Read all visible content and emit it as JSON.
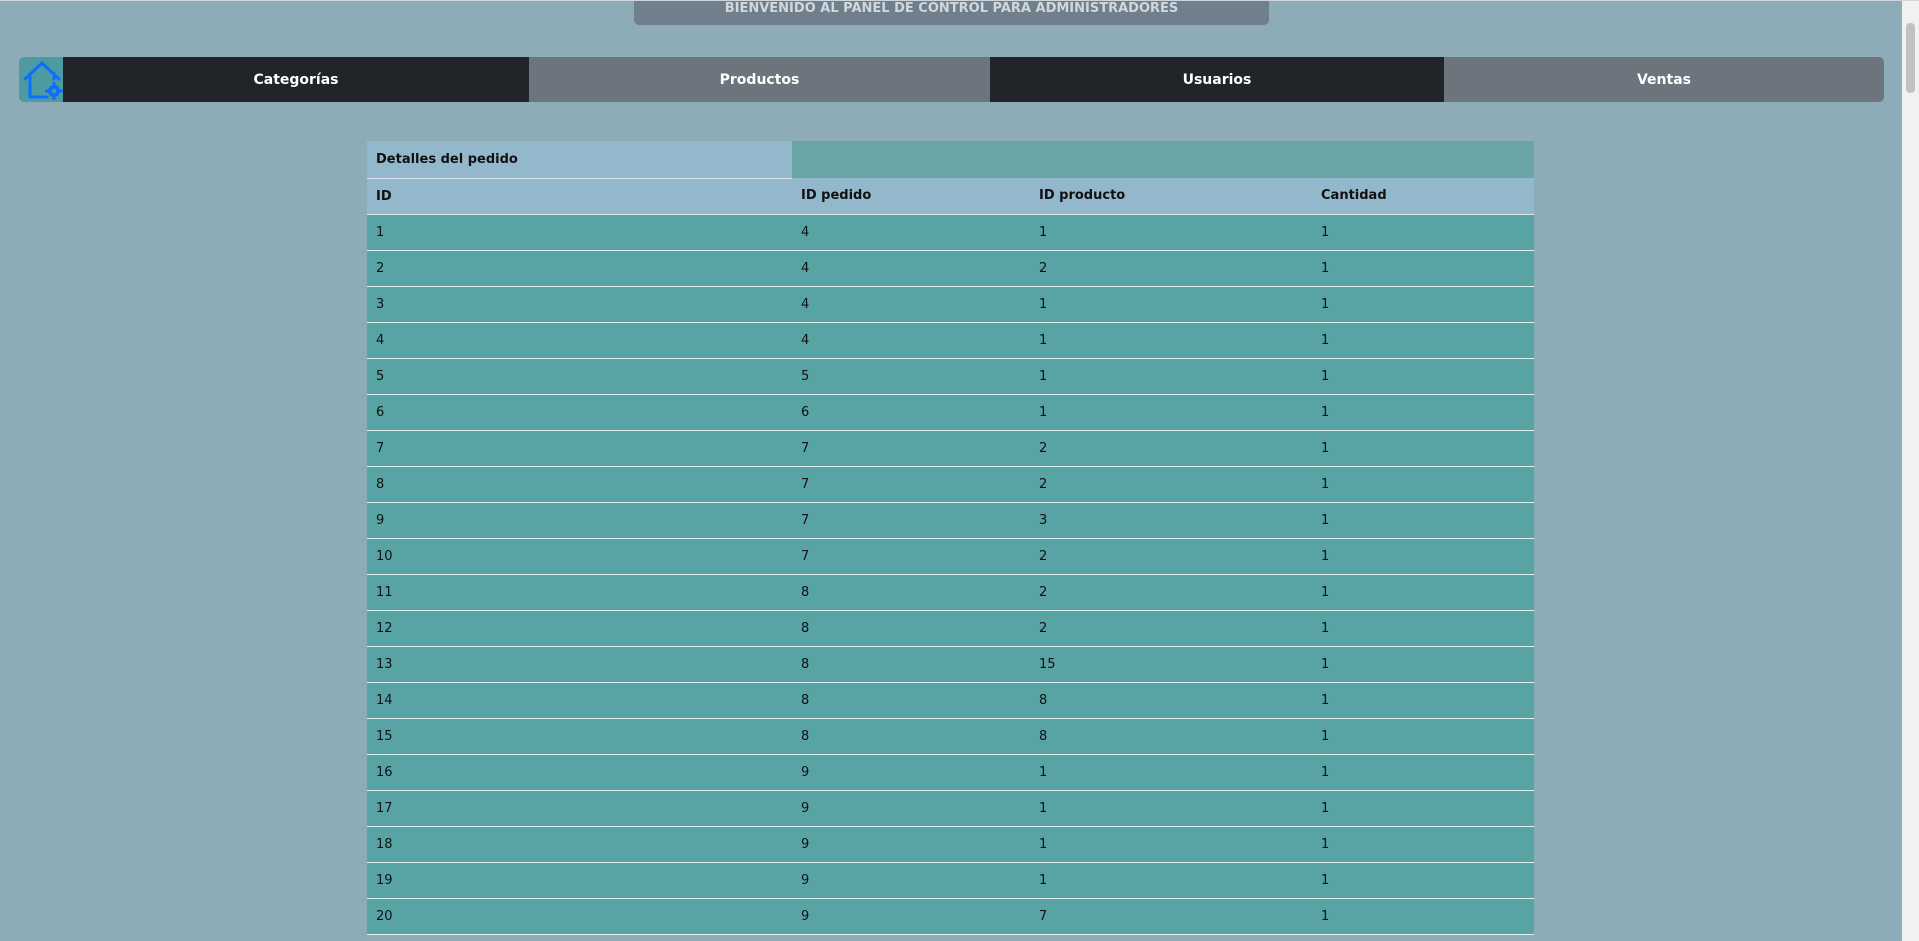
{
  "banner": {
    "text": "BIENVENIDO AL PANEL DE CONTROL PARA ADMINISTRADORES"
  },
  "nav": {
    "home_icon": "house-gear-icon",
    "items": [
      {
        "label": "Categorías"
      },
      {
        "label": "Productos"
      },
      {
        "label": "Usuarios"
      },
      {
        "label": "Ventas"
      }
    ]
  },
  "table": {
    "caption": "Detalles del pedido",
    "headers": [
      "ID",
      "ID pedido",
      "ID producto",
      "Cantidad"
    ],
    "rows": [
      [
        "1",
        "4",
        "1",
        "1"
      ],
      [
        "2",
        "4",
        "2",
        "1"
      ],
      [
        "3",
        "4",
        "1",
        "1"
      ],
      [
        "4",
        "4",
        "1",
        "1"
      ],
      [
        "5",
        "5",
        "1",
        "1"
      ],
      [
        "6",
        "6",
        "1",
        "1"
      ],
      [
        "7",
        "7",
        "2",
        "1"
      ],
      [
        "8",
        "7",
        "2",
        "1"
      ],
      [
        "9",
        "7",
        "3",
        "1"
      ],
      [
        "10",
        "7",
        "2",
        "1"
      ],
      [
        "11",
        "8",
        "2",
        "1"
      ],
      [
        "12",
        "8",
        "2",
        "1"
      ],
      [
        "13",
        "8",
        "15",
        "1"
      ],
      [
        "14",
        "8",
        "8",
        "1"
      ],
      [
        "15",
        "8",
        "8",
        "1"
      ],
      [
        "16",
        "9",
        "1",
        "1"
      ],
      [
        "17",
        "9",
        "1",
        "1"
      ],
      [
        "18",
        "9",
        "1",
        "1"
      ],
      [
        "19",
        "9",
        "1",
        "1"
      ],
      [
        "20",
        "9",
        "7",
        "1"
      ]
    ]
  },
  "colors": {
    "page_background": "#8eabb8",
    "nav_dark": "#212529",
    "nav_grey": "#6c757d",
    "table_row": "#58a4a4",
    "table_header": "#93b8cb",
    "icon_blue": "#0d6efd"
  }
}
